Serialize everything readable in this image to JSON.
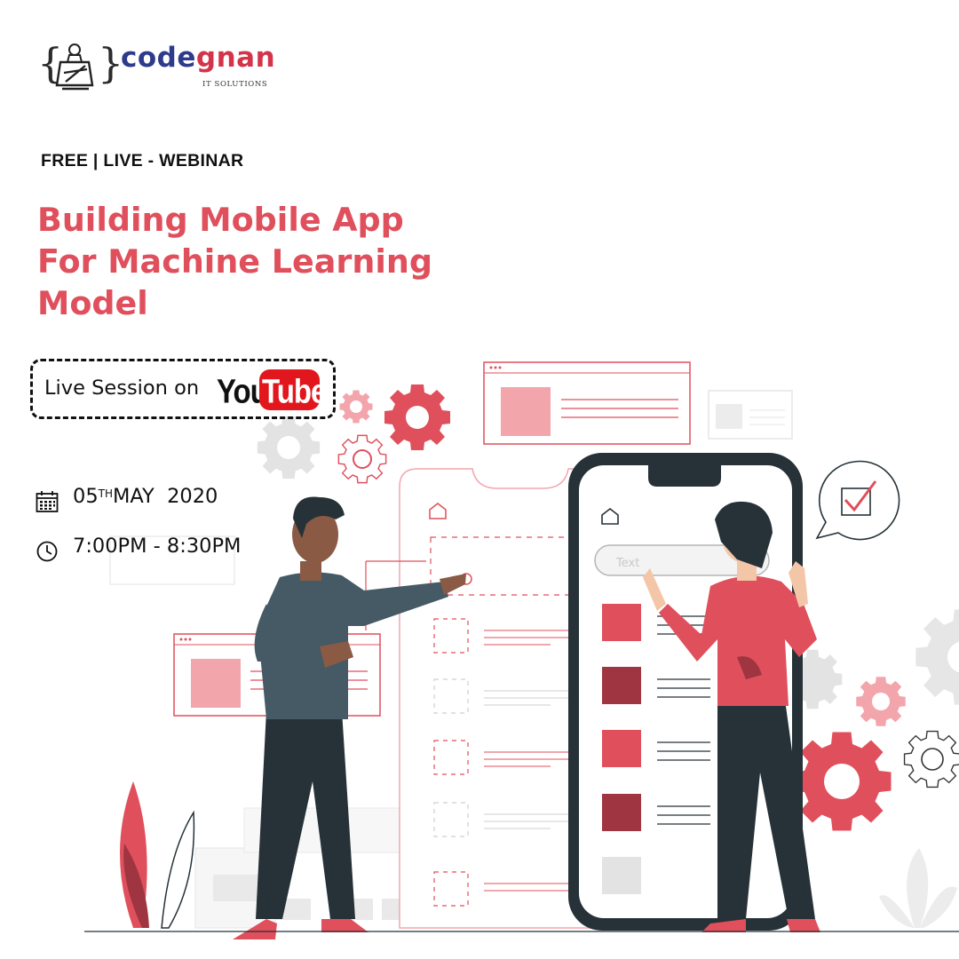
{
  "brand": {
    "name_part1": "code",
    "name_part2": "gnan",
    "tagline": "IT SOLUTIONS",
    "brace_left": "{",
    "brace_right": "}"
  },
  "event": {
    "kicker": "FREE | LIVE - WEBINAR",
    "title_lines": [
      "Building Mobile App",
      "For Machine Learning",
      "Model"
    ],
    "platform_text": "Live Session on",
    "platform_logo_you": "You",
    "platform_logo_tube": "Tube",
    "date_day": "05",
    "date_suffix": "TH",
    "date_rest": "MAY  2020",
    "time": "7:00PM - 8:30PM",
    "phone_search_placeholder": "Text"
  },
  "icons": {
    "logo": "person-at-laptop-icon",
    "date": "calendar-icon",
    "time": "clock-icon",
    "home": "home-icon",
    "check": "checkbox-checked-icon",
    "gear": "gear-icon",
    "leaf": "leaf-icon"
  },
  "colors": {
    "accent": "#e04f5c",
    "accent_dark": "#9e3541",
    "accent_light": "#f3a5ac",
    "brand_blue": "#2e3a8c",
    "brand_red": "#d3344a",
    "youtube_red": "#e2171d",
    "text_dark": "#111111",
    "figure_dark": "#263238",
    "gear_grey": "#e3e3e3"
  }
}
